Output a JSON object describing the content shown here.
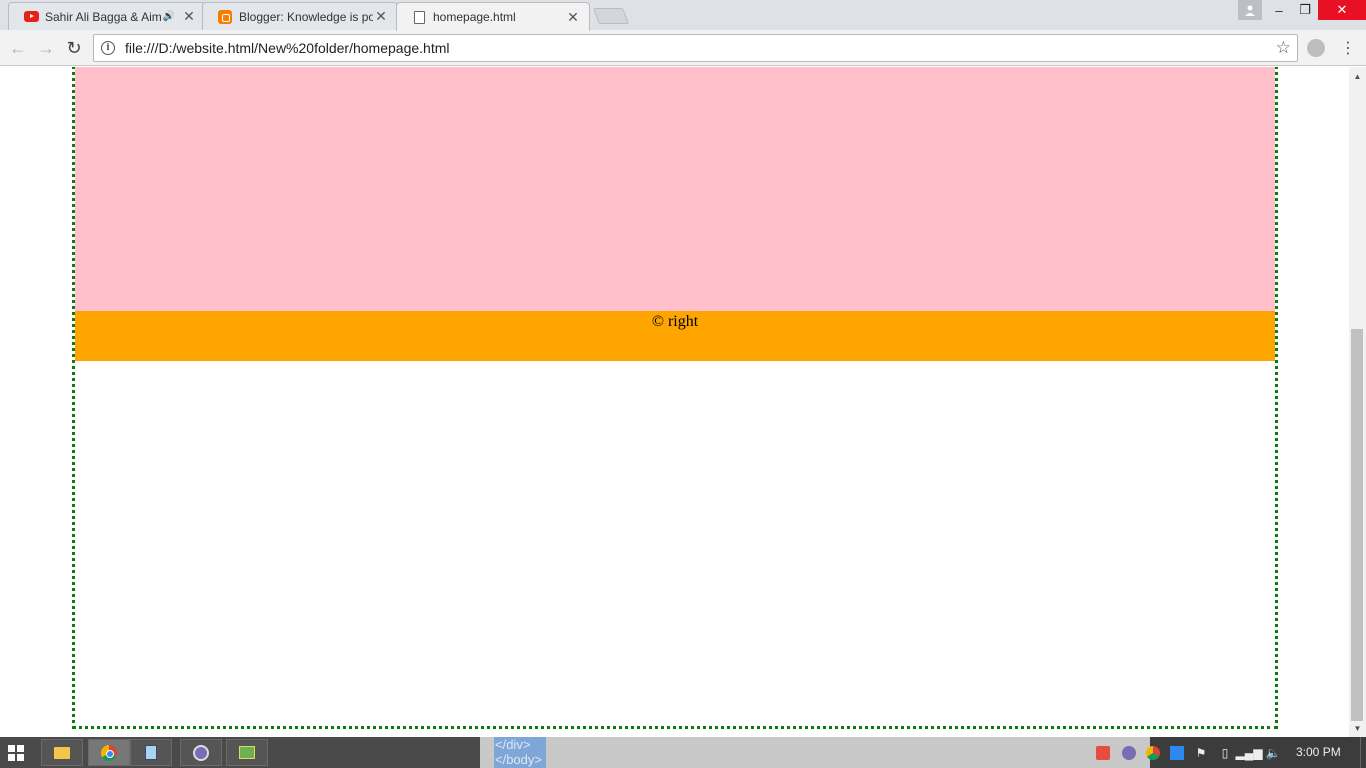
{
  "browser": {
    "tabs": [
      {
        "title": "Sahir Ali Bagga & Aim",
        "favicon": "youtube-icon",
        "audio": true,
        "active": false
      },
      {
        "title": "Blogger: Knowledge is po",
        "favicon": "blogger-icon",
        "audio": false,
        "active": false
      },
      {
        "title": "homepage.html",
        "favicon": "document-icon",
        "audio": false,
        "active": true
      }
    ],
    "close_glyph": "✕",
    "audio_glyph": "🔊",
    "window_controls": {
      "minimize": "–",
      "restore": "❐",
      "close": "✕"
    },
    "nav": {
      "back": "←",
      "forward": "→",
      "reload": "↻"
    },
    "address": "file:///D:/website.html/New%20folder/homepage.html",
    "star_glyph": "☆",
    "menu_glyph": "⋮"
  },
  "page": {
    "footer_text": "© right",
    "colors": {
      "pink_block": "#ffc0cb",
      "footer": "#ffa500",
      "container_border": "#0a7d0a"
    }
  },
  "taskbar": {
    "code_snippet_lines": [
      "</div>",
      "</body>"
    ],
    "clock": "3:00 PM"
  }
}
